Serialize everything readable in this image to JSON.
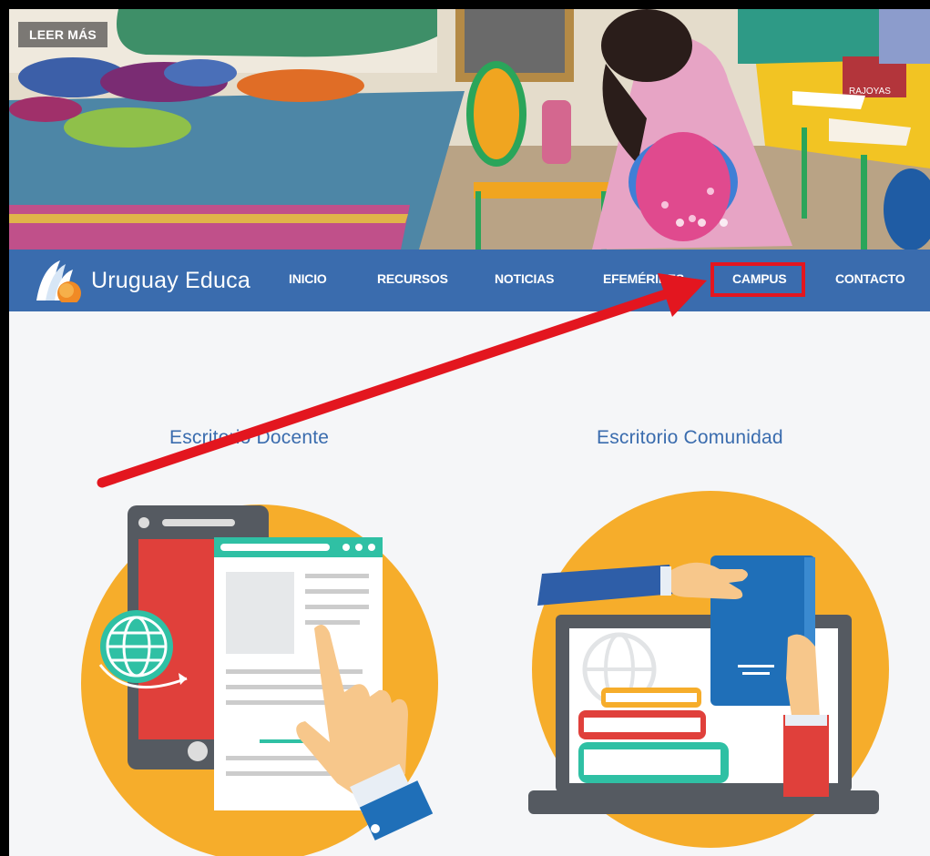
{
  "hero": {
    "cta_label": "LEER MÁS",
    "crate_text": "RAJOYAS"
  },
  "nav": {
    "brand": "Uruguay Educa",
    "items": [
      {
        "label": "INICIO"
      },
      {
        "label": "RECURSOS"
      },
      {
        "label": "NOTICIAS"
      },
      {
        "label": "EFEMÉRIDES"
      },
      {
        "label": "CAMPUS"
      },
      {
        "label": "CONTACTO"
      }
    ],
    "highlighted": "CAMPUS"
  },
  "cards": [
    {
      "title": "Escritorio Docente",
      "icon": "teacher-desk-illustration"
    },
    {
      "title": "Escritorio Comunidad",
      "icon": "community-desk-illustration"
    }
  ],
  "colors": {
    "nav_bg": "#3a6cae",
    "highlight": "#e3161f",
    "circle": "#f6ad2b",
    "title": "#3a6cae"
  }
}
